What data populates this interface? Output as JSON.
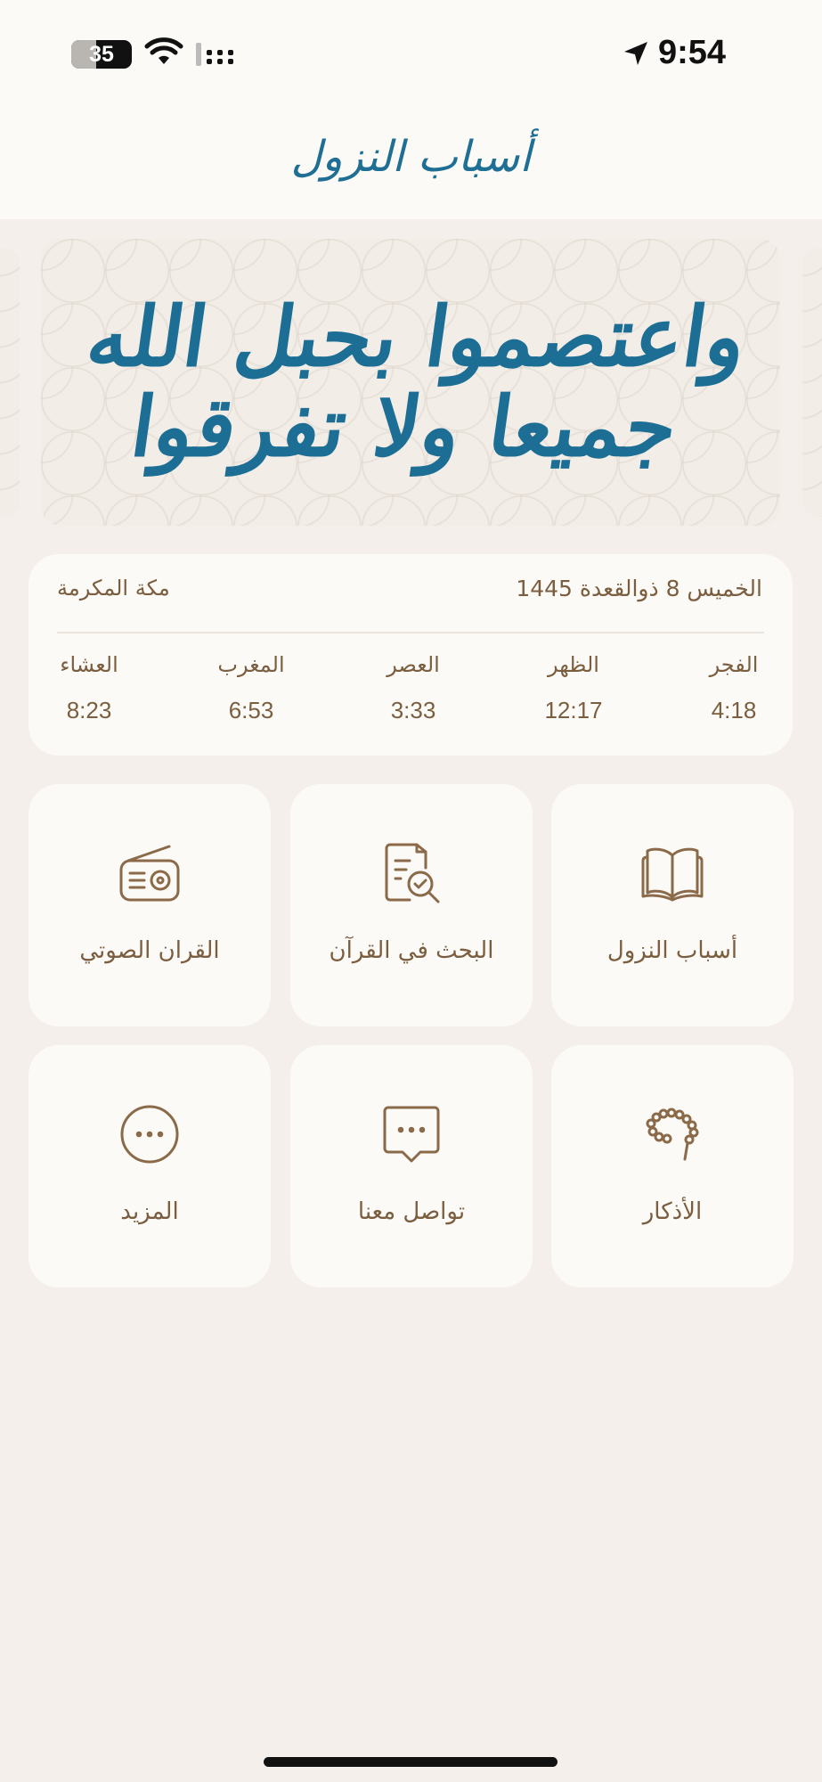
{
  "status_bar": {
    "time": "9:54",
    "battery": "35"
  },
  "header": {
    "title": "أسباب النزول"
  },
  "banner": {
    "calligraphy": "واعتصموا بحبل الله جميعا ولا تفرقوا"
  },
  "prayer_card": {
    "date": "الخميس 8 ذوالقعدة 1445",
    "city": "مكة المكرمة",
    "prayers": [
      {
        "name": "الفجر",
        "time": "4:18"
      },
      {
        "name": "الظهر",
        "time": "12:17"
      },
      {
        "name": "العصر",
        "time": "3:33"
      },
      {
        "name": "المغرب",
        "time": "6:53"
      },
      {
        "name": "العشاء",
        "time": "8:23"
      }
    ]
  },
  "tiles": [
    {
      "label": "أسباب النزول",
      "icon": "open-book-icon"
    },
    {
      "label": "البحث في القرآن",
      "icon": "document-search-icon"
    },
    {
      "label": "القران الصوتي",
      "icon": "radio-icon"
    },
    {
      "label": "الأذكار",
      "icon": "prayer-beads-icon"
    },
    {
      "label": "تواصل معنا",
      "icon": "chat-bubble-icon"
    },
    {
      "label": "المزيد",
      "icon": "more-icon"
    }
  ],
  "colors": {
    "accent": "#1d6e95",
    "brown": "#7a5e3f",
    "background": "#f4efea",
    "card": "#fcfaf7"
  }
}
